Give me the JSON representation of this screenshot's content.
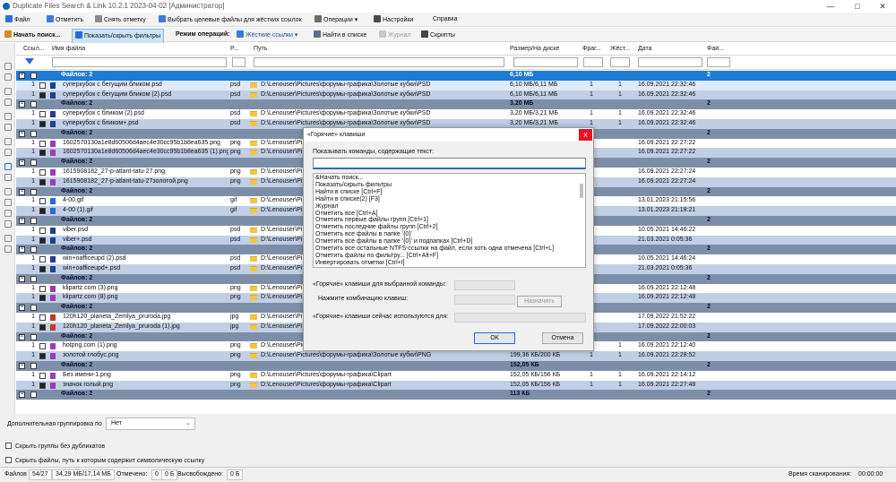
{
  "window": {
    "title": "Duplicate Files Search & Link 10.2.1 2023-04-02 [Администратор]",
    "controls": [
      "—",
      "□",
      "✕"
    ]
  },
  "menu": [
    "Файл",
    "Отметить",
    "Снять отметку",
    "Выбрать целевые файлы для жёстких ссылок",
    "Операции",
    "Настройки",
    "Справка"
  ],
  "toolbar": {
    "start_search": "Начать поиск...",
    "toggle_filters": "Показать/скрыть фильтры",
    "mode_label": "Режим операций:",
    "mode_value": "Жёсткие ссылки",
    "find_in_list": "Найти в списке",
    "journal": "Журнал",
    "scripts": "Скрипты"
  },
  "grid": {
    "columns": [
      "Ссыл...",
      "Имя файла",
      "Р...",
      "Путь",
      "Размер/На диске",
      "Фраг...",
      "Жёст...",
      "Дата",
      "Фай..."
    ],
    "rows": [
      {
        "kind": "group",
        "label": "Файлов: 2",
        "size": "6,10 МБ",
        "count": "2",
        "sel": true
      },
      {
        "kind": "file",
        "n": "1",
        "name": "суперкубок с бегущим бликом.psd",
        "ext": "psd",
        "path": "D:\\Lenouser\\Pictures\\форумы-графика\\Золотые кубки\\PSD",
        "size": "6,10 МБ/6,11 МБ",
        "frag": "1",
        "hard": "1",
        "date": "16.09.2021 22:32:46",
        "ic": "psd",
        "chk": false,
        "style": "selt"
      },
      {
        "kind": "file",
        "n": "1",
        "name": "суперкубок с бегущим бликом (2).psd",
        "ext": "psd",
        "path": "D:\\Lenouser\\Pictures\\форумы-графика\\Золотые кубки\\PSD",
        "size": "6,10 МБ/6,11 МБ",
        "frag": "1",
        "hard": "1",
        "date": "16.09.2021 22:32:46",
        "ic": "psd",
        "chk": true,
        "style": "alt"
      },
      {
        "kind": "group",
        "label": "Файлов: 2",
        "size": "3,20 МБ",
        "count": "2"
      },
      {
        "kind": "file",
        "n": "1",
        "name": "суперкубок с бликом (2).psd",
        "ext": "psd",
        "path": "D:\\Lenouser\\Pictures\\форумы-графика\\Золотые кубки\\PSD",
        "size": "3,20 МБ/3,21 МБ",
        "frag": "1",
        "hard": "1",
        "date": "16.09.2021 22:32:46",
        "ic": "psd",
        "chk": false,
        "style": ""
      },
      {
        "kind": "file",
        "n": "1",
        "name": "суперкубок с бликом+.psd",
        "ext": "psd",
        "path": "D:\\Lenouser\\Pictures\\форумы-графика\\Золотые кубки\\PSD",
        "size": "3,20 МБ/3,21 МБ",
        "frag": "1",
        "hard": "1",
        "date": "16.09.2021 22:32:46",
        "ic": "psd",
        "chk": true,
        "style": "alt"
      },
      {
        "kind": "group",
        "label": "Файлов: 2",
        "size": "",
        "count": "2"
      },
      {
        "kind": "file",
        "n": "1",
        "name": "1602570130a1e8d60506d4aec4e30cc95b1b8ea635.png",
        "ext": "png",
        "path": "D:\\Lenouser\\Pi",
        "size": "",
        "frag": "",
        "hard": "",
        "date": "16.09.2021 22:27:22",
        "ic": "png",
        "chk": false,
        "style": ""
      },
      {
        "kind": "file",
        "n": "1",
        "name": "1602570130a1e8d60506d4aec4e30cc95b1b8ea635 (1).png",
        "ext": "png",
        "path": "D:\\Lenouser\\Pi",
        "size": "",
        "frag": "",
        "hard": "",
        "date": "16.09.2021 22:27:22",
        "ic": "png",
        "chk": true,
        "style": "alt"
      },
      {
        "kind": "group",
        "label": "Файлов: 2",
        "size": "",
        "count": "2"
      },
      {
        "kind": "file",
        "n": "1",
        "name": "1615908182_27-p-atlant-tatu-27.png",
        "ext": "png",
        "path": "D:\\Lenouser\\Pi",
        "size": "",
        "frag": "",
        "hard": "",
        "date": "16.09.2021 22:27:24",
        "ic": "png",
        "chk": false,
        "style": ""
      },
      {
        "kind": "file",
        "n": "1",
        "name": "1615908182_27-p-atlant-tatu-27золотой.png",
        "ext": "png",
        "path": "D:\\Lenouser\\Pi",
        "size": "",
        "frag": "",
        "hard": "",
        "date": "16.09.2021 22:27:24",
        "ic": "png",
        "chk": true,
        "style": "alt"
      },
      {
        "kind": "group",
        "label": "Файлов: 2",
        "size": "",
        "count": "2"
      },
      {
        "kind": "file",
        "n": "1",
        "name": "4-00.gif",
        "ext": "gif",
        "path": "D:\\Lenouser\\Pi",
        "size": "",
        "frag": "",
        "hard": "",
        "date": "13.01.2023 21:15:56",
        "ic": "gif",
        "chk": false,
        "style": ""
      },
      {
        "kind": "file",
        "n": "1",
        "name": "4-00 (1).gif",
        "ext": "gif",
        "path": "D:\\Lenouser\\Pi",
        "size": "",
        "frag": "",
        "hard": "",
        "date": "13.01.2023 21:18:21",
        "ic": "gif",
        "chk": true,
        "style": "alt"
      },
      {
        "kind": "group",
        "label": "Файлов: 2",
        "size": "",
        "count": "2"
      },
      {
        "kind": "file",
        "n": "1",
        "name": "viber.psd",
        "ext": "psd",
        "path": "D:\\Lenouser\\Pi",
        "size": "",
        "frag": "",
        "hard": "",
        "date": "10.05.2021 14:46:22",
        "ic": "psd",
        "chk": false,
        "style": ""
      },
      {
        "kind": "file",
        "n": "1",
        "name": "viber+.psd",
        "ext": "psd",
        "path": "D:\\Lenouser\\Pi",
        "size": "",
        "frag": "",
        "hard": "",
        "date": "21.03.2021 0:05:36",
        "ic": "psd",
        "chk": true,
        "style": "alt"
      },
      {
        "kind": "group",
        "label": "Файлов: 2",
        "size": "",
        "count": "2"
      },
      {
        "kind": "file",
        "n": "1",
        "name": "win+oafficeupd (2).psd",
        "ext": "psd",
        "path": "D:\\Lenouser\\Pi",
        "size": "",
        "frag": "",
        "hard": "",
        "date": "10.05.2021 14:46:24",
        "ic": "psd",
        "chk": false,
        "style": ""
      },
      {
        "kind": "file",
        "n": "1",
        "name": "win+oafficeupd+.psd",
        "ext": "psd",
        "path": "D:\\Lenouser\\Pi",
        "size": "",
        "frag": "",
        "hard": "",
        "date": "21.03.2021 0:05:36",
        "ic": "psd",
        "chk": true,
        "style": "alt"
      },
      {
        "kind": "group",
        "label": "Файлов: 2",
        "size": "",
        "count": "2"
      },
      {
        "kind": "file",
        "n": "1",
        "name": "klipartz.com (3).png",
        "ext": "png",
        "path": "D:\\Lenouser\\Pi",
        "size": "",
        "frag": "",
        "hard": "",
        "date": "16.09.2021 22:12:48",
        "ic": "png",
        "chk": false,
        "style": ""
      },
      {
        "kind": "file",
        "n": "1",
        "name": "klipartz.com (8).png",
        "ext": "png",
        "path": "D:\\Lenouser\\Pi",
        "size": "",
        "frag": "",
        "hard": "",
        "date": "16.09.2021 22:12:48",
        "ic": "png",
        "chk": true,
        "style": "alt"
      },
      {
        "kind": "group",
        "label": "Файлов: 2",
        "size": "",
        "count": "2"
      },
      {
        "kind": "file",
        "n": "1",
        "name": "120h120_planeta_Zemlya_pruroda.jpg",
        "ext": "jpg",
        "path": "D:\\Lenouser\\Pi",
        "size": "",
        "frag": "",
        "hard": "",
        "date": "17.09.2022 21:52:22",
        "ic": "jpg",
        "chk": false,
        "style": ""
      },
      {
        "kind": "file",
        "n": "1",
        "name": "120h120_planeta_Zemlya_pruroda (1).jpg",
        "ext": "jpg",
        "path": "D:\\Lenouser\\Pi",
        "size": "",
        "frag": "",
        "hard": "",
        "date": "17.09.2022 22:00:03",
        "ic": "jpg",
        "chk": true,
        "style": "alt"
      },
      {
        "kind": "group",
        "label": "Файлов: 2",
        "size": "",
        "count": "2"
      },
      {
        "kind": "file",
        "n": "1",
        "name": "hotpng.com (1).png",
        "ext": "png",
        "path": "D:\\Lenouser\\Pictures\\форумы-графика\\Clipart",
        "size": "199,36 КБ/200 КБ",
        "frag": "1",
        "hard": "1",
        "date": "16.09.2021 22:12:40",
        "ic": "png",
        "chk": false,
        "style": ""
      },
      {
        "kind": "file",
        "n": "1",
        "name": "золотой глобус.png",
        "ext": "png",
        "path": "D:\\Lenouser\\Pictures\\форумы-графика\\Золотые кубки\\PNG",
        "size": "199,36 КБ/200 КБ",
        "frag": "1",
        "hard": "1",
        "date": "16.09.2021 22:28:52",
        "ic": "png",
        "chk": true,
        "style": "alt"
      },
      {
        "kind": "group",
        "label": "Файлов: 2",
        "size": "152,05 КБ",
        "count": "2"
      },
      {
        "kind": "file",
        "n": "1",
        "name": "Без имени-1.png",
        "ext": "png",
        "path": "D:\\Lenouser\\Pictures\\форумы-графика\\Clipart",
        "size": "152,05 КБ/156 КБ",
        "frag": "1",
        "hard": "1",
        "date": "16.09.2021 22:14:12",
        "ic": "png",
        "chk": false,
        "style": ""
      },
      {
        "kind": "file",
        "n": "1",
        "name": "значок голый.png",
        "ext": "png",
        "path": "D:\\Lenouser\\Pictures\\форумы-графика\\Clipart",
        "size": "152,05 КБ/156 КБ",
        "frag": "1",
        "hard": "1",
        "date": "16.09.2021 22:27:48",
        "ic": "png",
        "chk": true,
        "style": "alt"
      },
      {
        "kind": "group",
        "label": "Файлов: 2",
        "size": "113 КБ",
        "count": "2"
      }
    ]
  },
  "bottom": {
    "grouping_label": "Дополнительная группировка по",
    "grouping_value": "Нет",
    "opt_hide_groups": "Скрыть группы без дубликатов",
    "opt_hide_symlink": "Скрыть файлы, путь к которым содержит символическую ссылку"
  },
  "status": {
    "files_label": "Файлов",
    "files_value": "54/27",
    "sizes_value": "34,29 МБ/17,14 МБ",
    "marked_label": "Отмечено:",
    "marked_count": "0",
    "marked_size": "0 Б",
    "freed_label": "Высвобождено:",
    "freed_value": "0 Б",
    "scan_label": "Время сканирования:",
    "scan_value": "00:00:00"
  },
  "dialog": {
    "title": "«Горячие» клавиши",
    "close": "x",
    "search_label": "Показывать команды, содержащие текст:",
    "search_value": "",
    "commands": [
      "&Начать поиск...",
      "Показать/скрыть фильтры",
      "Найти в списке [Ctrl+F]",
      "Найти в списке(2) [F3]",
      "Журнал",
      "Отметить все [Ctrl+A]",
      "Отметить первые файлы групп [Ctrl+1]",
      "Отметить последние файлы групп [Ctrl+2]",
      "Отметить все файлы в папке '{0}'",
      "Отметить все файлы в папке '{0}' и подпапках [Ctrl+D]",
      "Отметить все остальные NTFS-ссылки на файл, если хоть одна отмечена [Ctrl+L]",
      "Отметить файлы по фильтру... [Ctrl+Alt+F]",
      "Инвертировать отметки [Ctrl+I]"
    ],
    "hotkey_label": "«Горячие» клавиши для выбранной команды:",
    "press_label": "Нажмите комбинацию клавиш:",
    "assign": "Назначить",
    "used_label": "«Горячие» клавиши сейчас используются для:",
    "ok": "ОК",
    "cancel": "Отмена"
  },
  "colors": {
    "selected_group": "#1e7ad6",
    "group": "#7d8fa8",
    "alt_row": "#c0cfe6",
    "close_red": "#e81123",
    "accent": "#1e6fd0"
  }
}
